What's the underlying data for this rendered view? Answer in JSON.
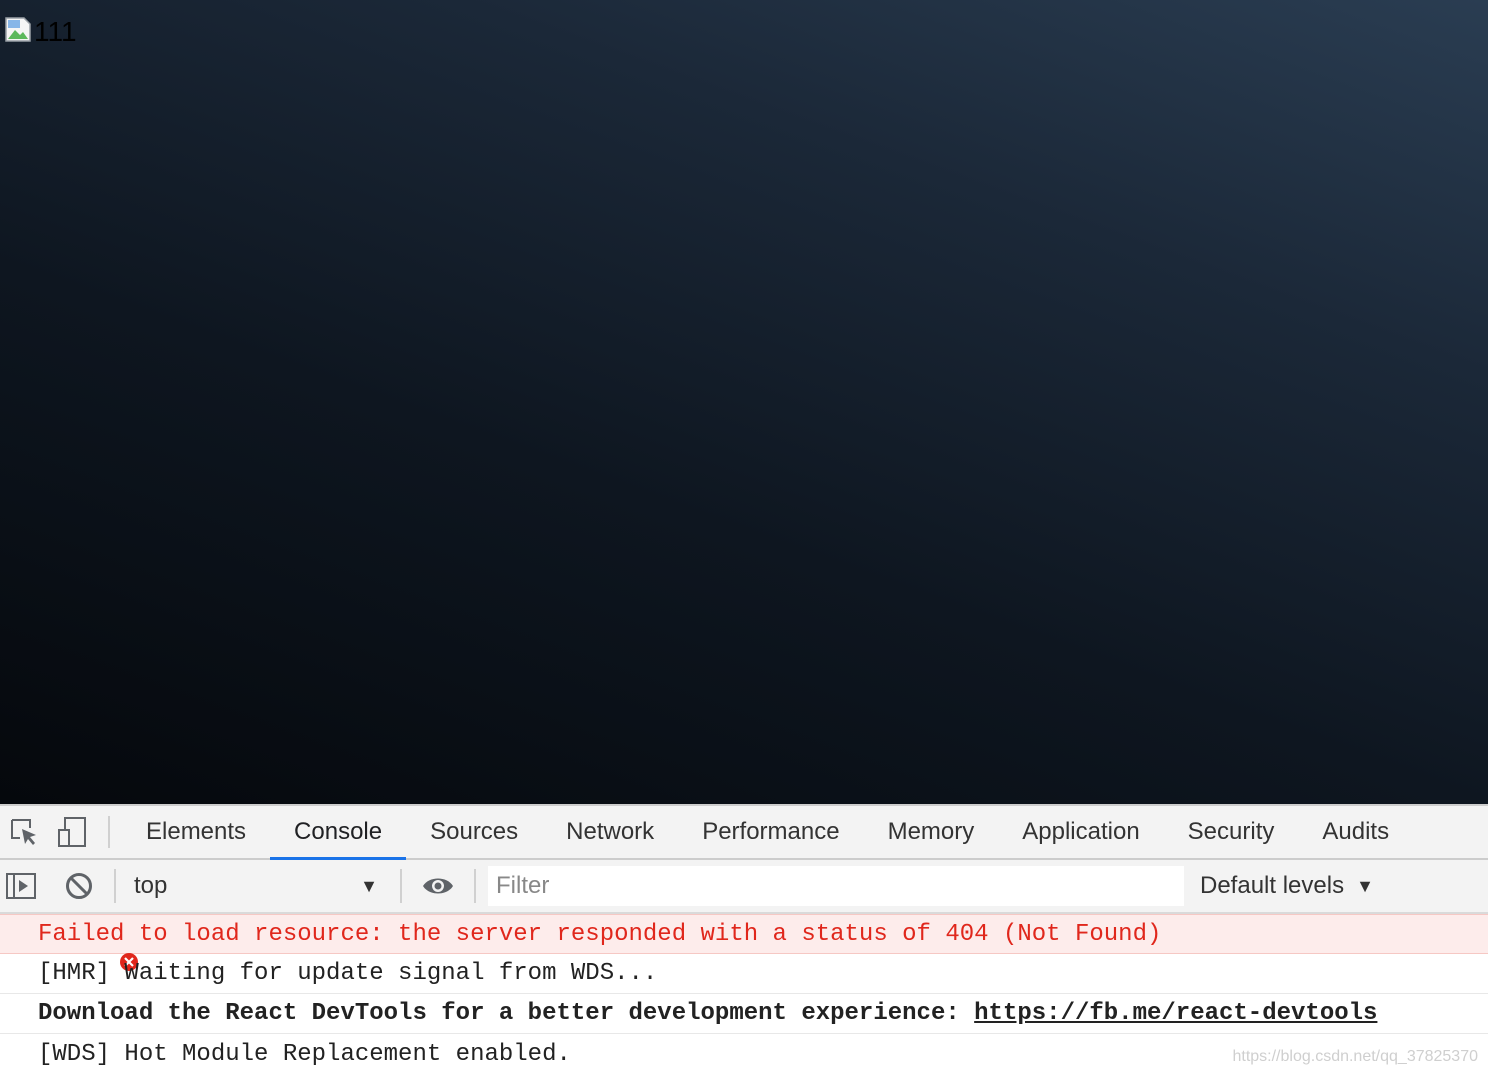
{
  "page": {
    "image_alt": "111"
  },
  "devtools": {
    "tabs": [
      {
        "label": "Elements"
      },
      {
        "label": "Console",
        "active": true
      },
      {
        "label": "Sources"
      },
      {
        "label": "Network"
      },
      {
        "label": "Performance"
      },
      {
        "label": "Memory"
      },
      {
        "label": "Application"
      },
      {
        "label": "Security"
      },
      {
        "label": "Audits"
      }
    ],
    "toolbar": {
      "context": "top",
      "filter_placeholder": "Filter",
      "levels": "Default levels"
    },
    "messages": [
      {
        "type": "error",
        "text": "Failed to load resource: the server responded with a status of 404 (Not Found)"
      },
      {
        "type": "log",
        "text": "[HMR] Waiting for update signal from WDS..."
      },
      {
        "type": "log-bold",
        "text": "Download the React DevTools for a better development experience: ",
        "link": "https://fb.me/react-devtools"
      },
      {
        "type": "log",
        "text": "[WDS] Hot Module Replacement enabled."
      }
    ],
    "watermark": "https://blog.csdn.net/qq_37825370"
  },
  "colors": {
    "active_tab_underline": "#1a73e8",
    "error_text": "#e0271c",
    "error_bg": "#fdeceb"
  }
}
